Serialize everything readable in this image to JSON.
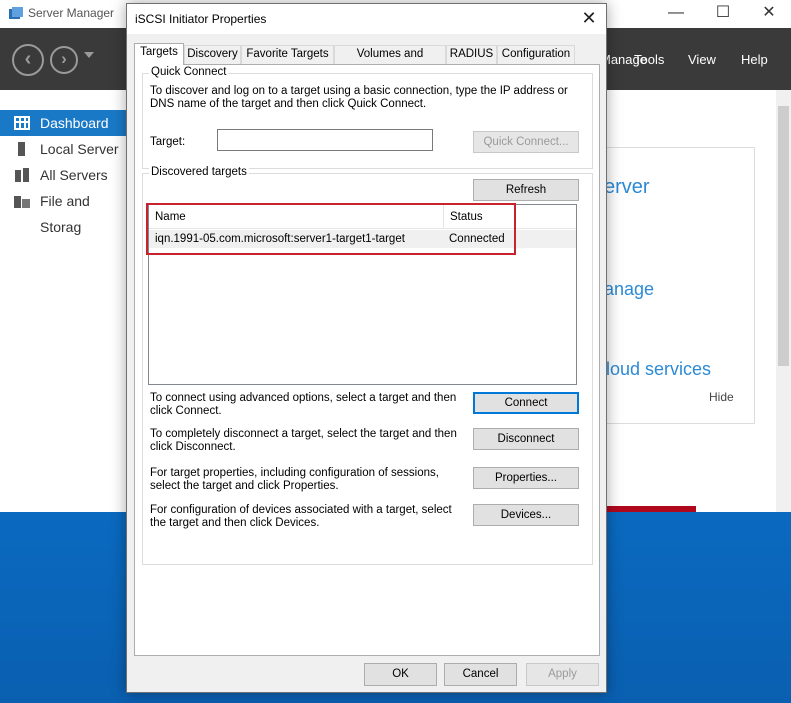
{
  "server_manager": {
    "title": "Server Manager",
    "menu": [
      "Manage",
      "Tools",
      "View",
      "Help"
    ],
    "sidebar": [
      {
        "label": "Dashboard",
        "active": true
      },
      {
        "label": "Local Server",
        "active": false
      },
      {
        "label": "All Servers",
        "active": false
      },
      {
        "label": "File and Storag",
        "active": false
      }
    ],
    "panel": {
      "line1": "erver",
      "line2": "anage",
      "line3": "loud services",
      "hide": "Hide"
    }
  },
  "dialog": {
    "title": "iSCSI Initiator Properties",
    "close_glyph": "✕",
    "tabs": [
      "Targets",
      "Discovery",
      "Favorite Targets",
      "Volumes and Devices",
      "RADIUS",
      "Configuration"
    ],
    "active_tab": "Targets",
    "quick_connect": {
      "group_label": "Quick Connect",
      "description": "To discover and log on to a target using a basic connection, type the IP address or DNS name of the target and then click Quick Connect.",
      "target_label": "Target:",
      "target_value": "",
      "button": "Quick Connect..."
    },
    "discovered": {
      "group_label": "Discovered targets",
      "refresh_button": "Refresh",
      "columns": [
        "Name",
        "Status"
      ],
      "rows": [
        {
          "name": "iqn.1991-05.com.microsoft:server1-target1-target",
          "status": "Connected"
        }
      ]
    },
    "actions": [
      {
        "text": "To connect using advanced options, select a target and then click Connect.",
        "button": "Connect"
      },
      {
        "text": "To completely disconnect a target, select the target and then click Disconnect.",
        "button": "Disconnect"
      },
      {
        "text": "For target properties, including configuration of sessions, select the target and click Properties.",
        "button": "Properties..."
      },
      {
        "text": "For configuration of devices associated with a target, select the target and then click Devices.",
        "button": "Devices..."
      }
    ],
    "footer": {
      "ok": "OK",
      "cancel": "Cancel",
      "apply": "Apply"
    }
  },
  "colors": {
    "accent": "#0078d7",
    "highlight_box": "#c8232c",
    "sm_header": "#3a3a3a",
    "sidebar_active": "#1a79c7"
  }
}
